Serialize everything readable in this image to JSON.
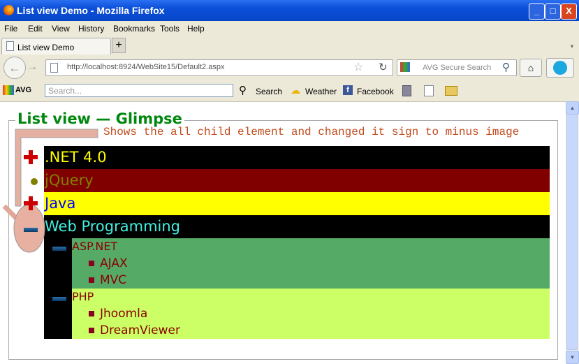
{
  "window": {
    "title": "List view Demo - Mozilla Firefox",
    "min": "_",
    "max": "□",
    "close": "X"
  },
  "menu": [
    "File",
    "Edit",
    "View",
    "History",
    "Bookmarks",
    "Tools",
    "Help"
  ],
  "tab": {
    "label": "List view Demo",
    "new": "+"
  },
  "nav": {
    "url": "http://localhost:8924/WebSite15/Default2.aspx",
    "search_placeholder": "AVG Secure Search"
  },
  "avg": {
    "logo": "AVG",
    "search_placeholder": "Search...",
    "search": "Search",
    "weather": "Weather",
    "facebook": "Facebook"
  },
  "page": {
    "legend": "List view — Glimpse",
    "note": "Shows the all child element and changed it sign to minus image",
    "items": [
      {
        "label": ".NET 4.0",
        "bg": "#000000",
        "fg": "#ffff00"
      },
      {
        "label": "jQuery",
        "bg": "#800000",
        "fg": "#808000"
      },
      {
        "label": "Java",
        "bg": "#ffff00",
        "fg": "#0000ff"
      },
      {
        "label": "Web Programming",
        "bg": "#000000",
        "fg": "#40f0e0"
      }
    ],
    "groups": [
      {
        "label": "ASP.NET",
        "bg": "#55aa66",
        "children": [
          "AJAX",
          "MVC"
        ]
      },
      {
        "label": "PHP",
        "bg": "#ccff66",
        "children": [
          "Jhoomla",
          "DreamViewer"
        ]
      }
    ]
  }
}
